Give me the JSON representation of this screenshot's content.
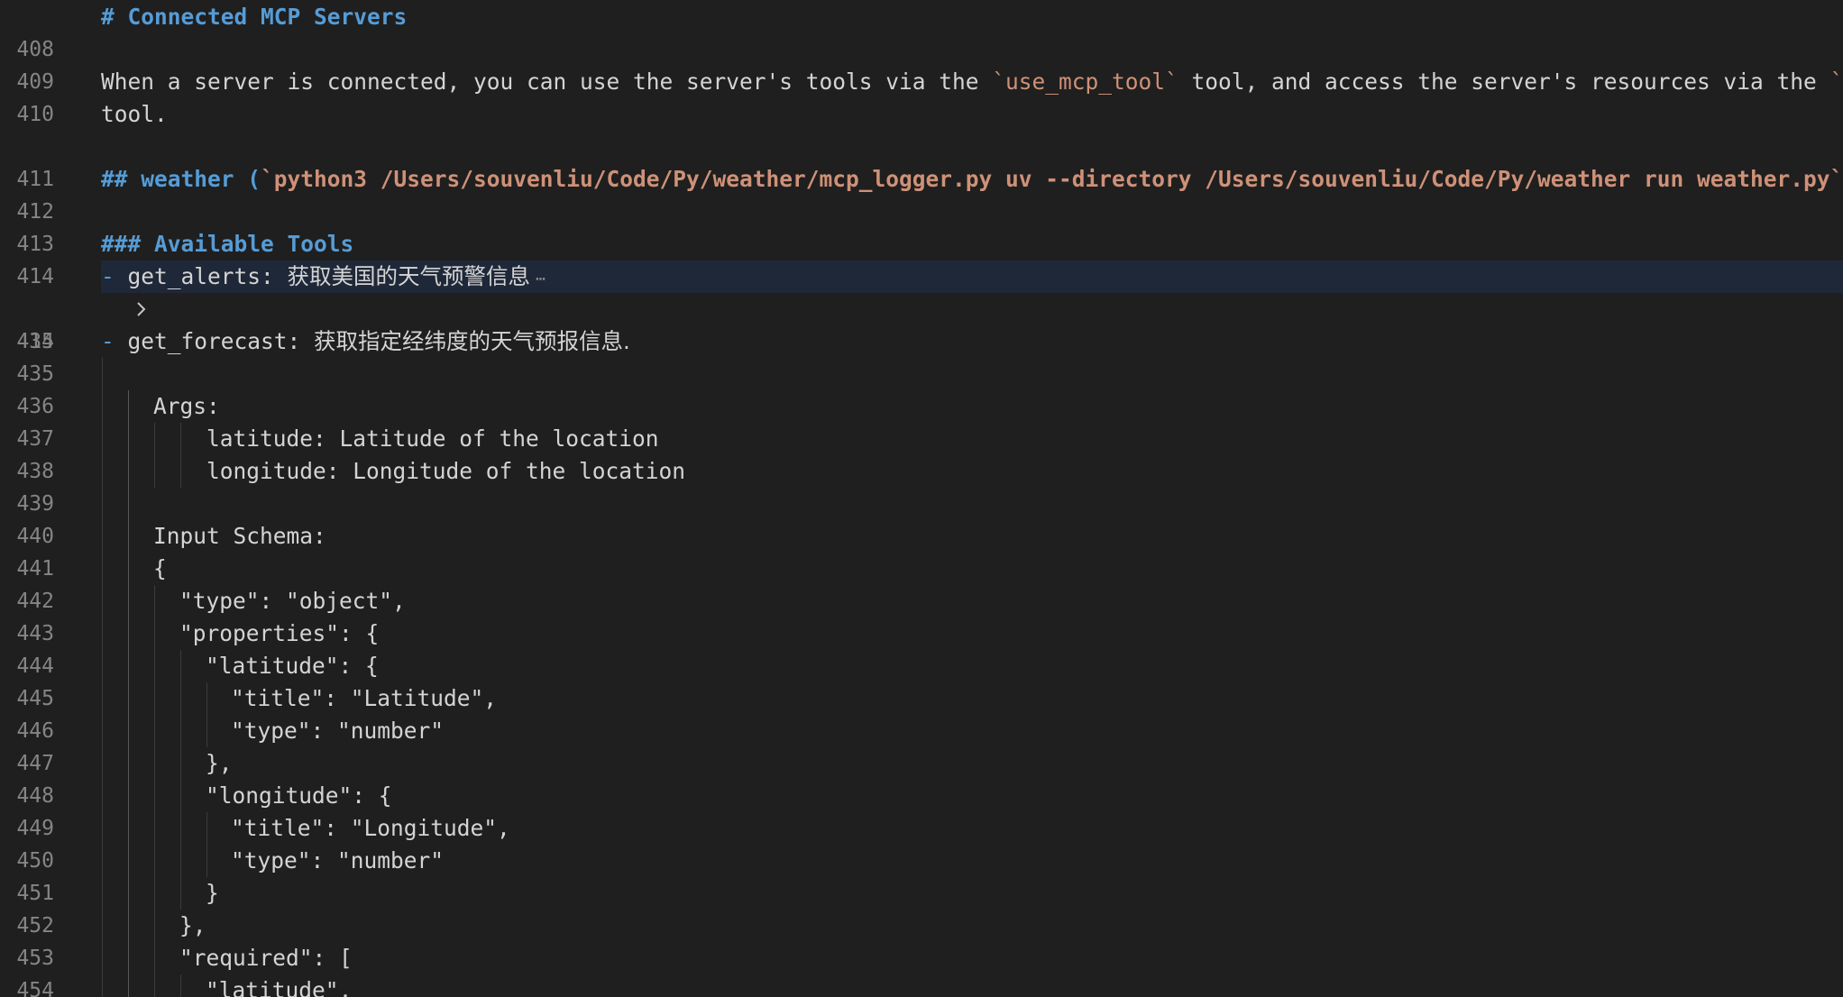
{
  "editor": {
    "lines": [
      {
        "num": "408",
        "kind": "heading",
        "text": "# Connected MCP Servers"
      },
      {
        "num": "409",
        "kind": "blank"
      },
      {
        "num": "410",
        "kind": "para",
        "pre": "When a server is connected, you can use the server's tools via the ",
        "code1": "`use_mcp_tool`",
        "mid": " tool, and access the server's resources via the ",
        "code2": "`access_mcp_resource`",
        "wrap": "tool."
      },
      {
        "num": "411",
        "kind": "blank"
      },
      {
        "num": "412",
        "kind": "heading2",
        "hash": "## weather (",
        "code": "`python3 /Users/souvenliu/Code/Py/weather/mcp_logger.py uv --directory /Users/souvenliu/Code/Py/weather run weather.py`",
        "close": ")"
      },
      {
        "num": "413",
        "kind": "blank"
      },
      {
        "num": "414",
        "kind": "heading",
        "text": "### Available Tools"
      },
      {
        "num": "415",
        "kind": "folded",
        "dash": "-",
        "name": " get_alerts: ",
        "desc": "获取美国的天气预警信息",
        "ellipsis": "⋯"
      },
      {
        "num": "434",
        "kind": "blank"
      },
      {
        "num": "435",
        "kind": "item",
        "dash": "-",
        "name": " get_forecast: ",
        "desc": "获取指定经纬度的天气预报信息."
      },
      {
        "num": "436",
        "kind": "blank"
      },
      {
        "num": "437",
        "kind": "text",
        "indent": 2,
        "text": "Args:"
      },
      {
        "num": "438",
        "kind": "text",
        "indent": 4,
        "text": "latitude: Latitude of the location"
      },
      {
        "num": "439",
        "kind": "text",
        "indent": 4,
        "text": "longitude: Longitude of the location"
      },
      {
        "num": "440",
        "kind": "blank"
      },
      {
        "num": "441",
        "kind": "text",
        "indent": 2,
        "text": "Input Schema:"
      },
      {
        "num": "442",
        "kind": "text",
        "indent": 2,
        "text": "{"
      },
      {
        "num": "443",
        "kind": "text",
        "indent": 3,
        "text": "\"type\": \"object\","
      },
      {
        "num": "444",
        "kind": "text",
        "indent": 3,
        "text": "\"properties\": {"
      },
      {
        "num": "445",
        "kind": "text",
        "indent": 4,
        "text": "\"latitude\": {"
      },
      {
        "num": "446",
        "kind": "text",
        "indent": 5,
        "text": "\"title\": \"Latitude\","
      },
      {
        "num": "447",
        "kind": "text",
        "indent": 5,
        "text": "\"type\": \"number\""
      },
      {
        "num": "448",
        "kind": "text",
        "indent": 4,
        "text": "},"
      },
      {
        "num": "449",
        "kind": "text",
        "indent": 4,
        "text": "\"longitude\": {"
      },
      {
        "num": "450",
        "kind": "text",
        "indent": 5,
        "text": "\"title\": \"Longitude\","
      },
      {
        "num": "451",
        "kind": "text",
        "indent": 5,
        "text": "\"type\": \"number\""
      },
      {
        "num": "452",
        "kind": "text",
        "indent": 4,
        "text": "}"
      },
      {
        "num": "453",
        "kind": "text",
        "indent": 3,
        "text": "},"
      },
      {
        "num": "454",
        "kind": "text",
        "indent": 3,
        "text": "\"required\": ["
      },
      {
        "num": "455",
        "kind": "text",
        "indent": 4,
        "text": "\"latitude\","
      }
    ]
  },
  "colors": {
    "background": "#1f1f1f",
    "heading": "#569cd6",
    "code": "#ce9178",
    "text": "#d4d4d4",
    "line_number": "#858585",
    "highlight": "#1f2838"
  },
  "icons": {
    "fold": "chevron-right-icon"
  }
}
